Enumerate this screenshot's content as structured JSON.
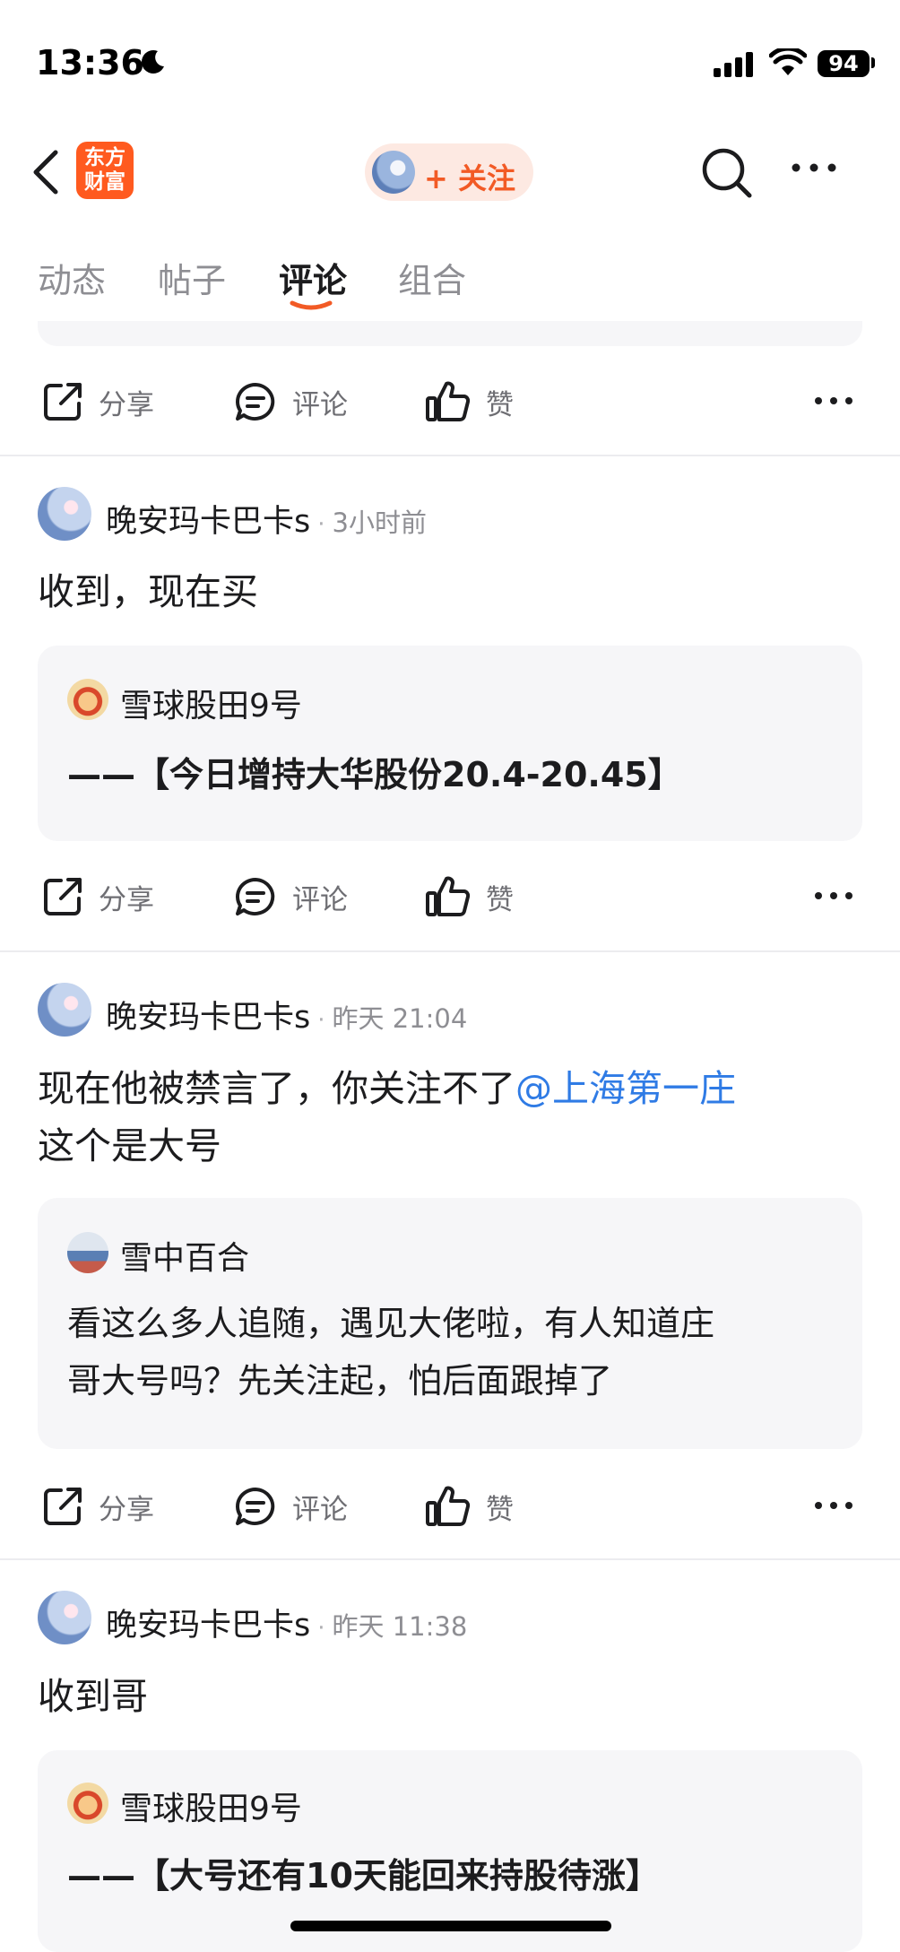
{
  "status_bar": {
    "time": "13:36",
    "battery": "94"
  },
  "nav": {
    "logo_line1": "东方",
    "logo_line2": "财富",
    "follow_label": "+ 关注"
  },
  "tabs": [
    {
      "label": "动态",
      "active": false
    },
    {
      "label": "帖子",
      "active": false
    },
    {
      "label": "评论",
      "active": true
    },
    {
      "label": "组合",
      "active": false
    }
  ],
  "actions": {
    "share": "分享",
    "comment": "评论",
    "like": "赞"
  },
  "comments": [
    {
      "user": "晚安玛卡巴卡s",
      "time": "3小时前",
      "text": "收到，现在买",
      "quote": {
        "user": "雪球股田9号",
        "text": "——【今日增持大华股份20.4-20.45】"
      }
    },
    {
      "user": "晚安玛卡巴卡s",
      "time": "昨天 21:04",
      "text_before": "现在他被禁言了，你关注不了",
      "mention": "@上海第一庄",
      "text_after": "这个是大号",
      "quote": {
        "user": "雪中百合",
        "line1": "看这么多人追随，遇见大佬啦，有人知道庄",
        "line2": "哥大号吗？先关注起，怕后面跟掉了"
      }
    },
    {
      "user": "晚安玛卡巴卡s",
      "time": "昨天 11:38",
      "text": "收到哥",
      "quote": {
        "user": "雪球股田9号",
        "text": "——【大号还有10天能回来持股待涨】"
      }
    }
  ],
  "colors": {
    "accent": "#f25a25",
    "mention": "#2f7be5",
    "quote_bg": "#f6f6f8"
  }
}
